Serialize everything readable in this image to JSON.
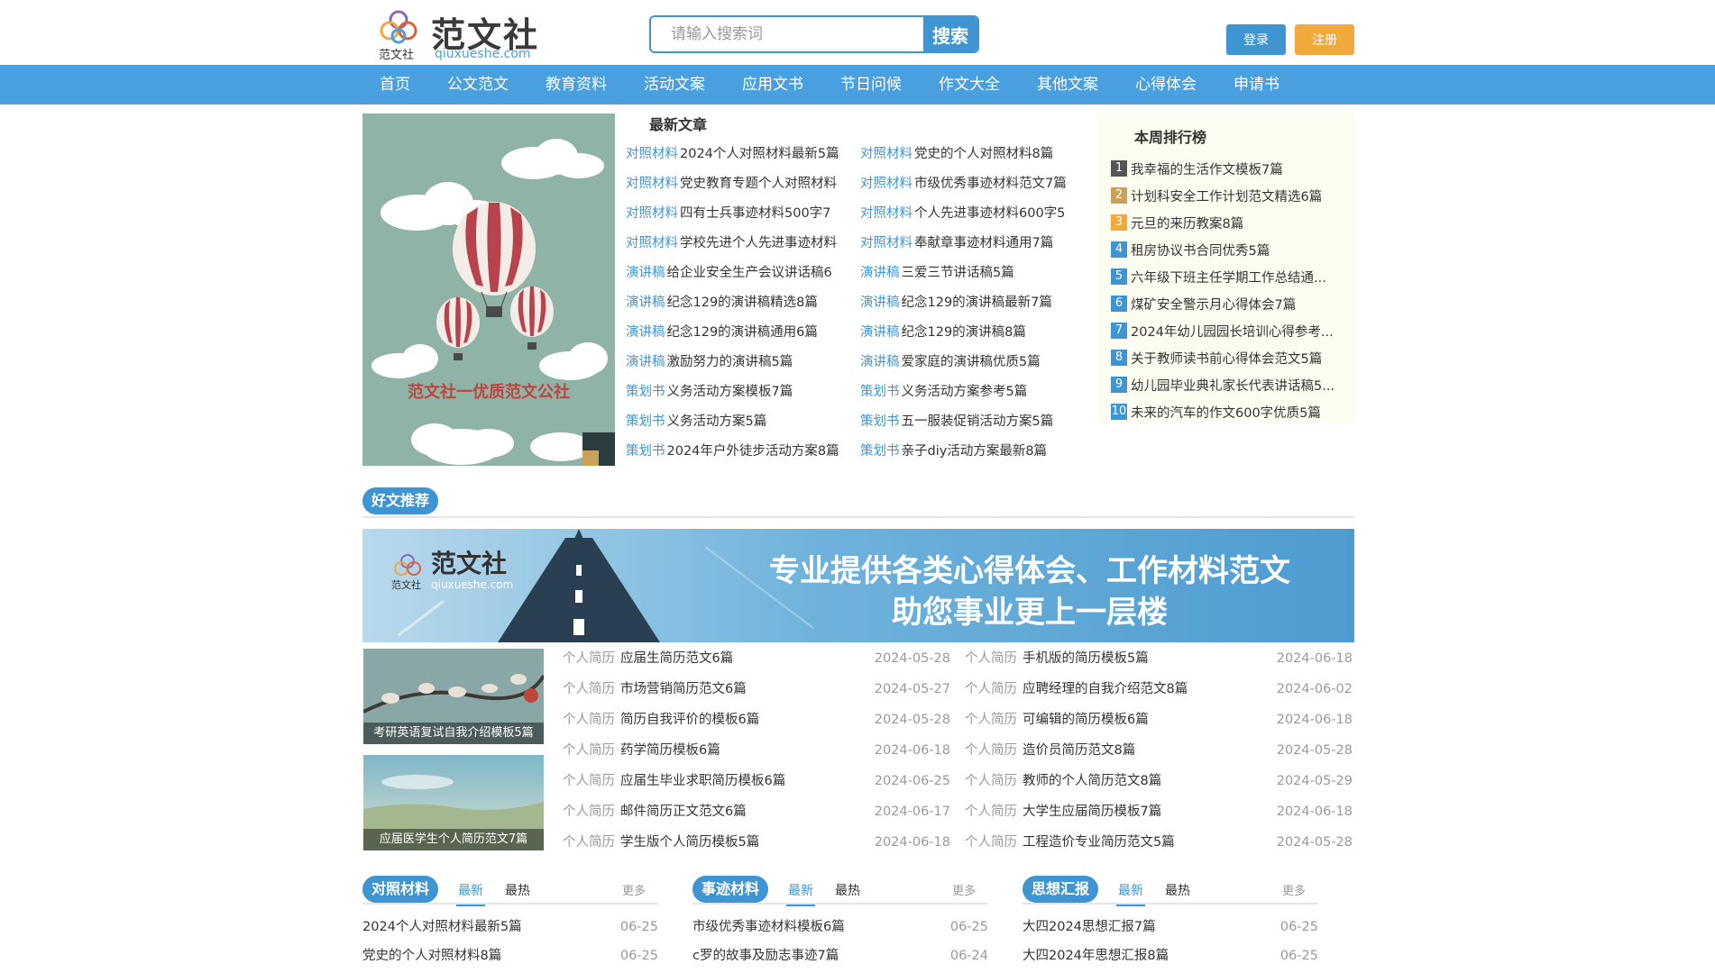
{
  "header": {
    "logo_name": "范文社",
    "logo_sub": "范文社",
    "logo_url": "qiuxueshe.com",
    "search_placeholder": "请输入搜索词",
    "search_label": "搜索",
    "login_label": "登录",
    "register_label": "注册"
  },
  "nav": [
    "首页",
    "公文范文",
    "教育资料",
    "活动文案",
    "应用文书",
    "节日问候",
    "作文大全",
    "其他文案",
    "心得体会",
    "申请书"
  ],
  "hero": {
    "caption": "范文社一优质范文公社"
  },
  "latest": {
    "heading": "最新文章",
    "items": [
      {
        "cat": "对照材料",
        "title": "2024个人对照材料最新5篇"
      },
      {
        "cat": "对照材料",
        "title": "党史的个人对照材料8篇"
      },
      {
        "cat": "对照材料",
        "title": "党史教育专题个人对照材料"
      },
      {
        "cat": "对照材料",
        "title": "市级优秀事迹材料范文7篇"
      },
      {
        "cat": "对照材料",
        "title": "四有士兵事迹材料500字7"
      },
      {
        "cat": "对照材料",
        "title": "个人先进事迹材料600字5"
      },
      {
        "cat": "对照材料",
        "title": "学校先进个人先进事迹材料"
      },
      {
        "cat": "对照材料",
        "title": "奉献章事迹材料通用7篇"
      },
      {
        "cat": "演讲稿",
        "title": "给企业安全生产会议讲话稿6"
      },
      {
        "cat": "演讲稿",
        "title": "三爱三节讲话稿5篇"
      },
      {
        "cat": "演讲稿",
        "title": "纪念129的演讲稿精选8篇"
      },
      {
        "cat": "演讲稿",
        "title": "纪念129的演讲稿最新7篇"
      },
      {
        "cat": "演讲稿",
        "title": "纪念129的演讲稿通用6篇"
      },
      {
        "cat": "演讲稿",
        "title": "纪念129的演讲稿8篇"
      },
      {
        "cat": "演讲稿",
        "title": "激励努力的演讲稿5篇"
      },
      {
        "cat": "演讲稿",
        "title": "爱家庭的演讲稿优质5篇"
      },
      {
        "cat": "策划书",
        "title": "义务活动方案模板7篇"
      },
      {
        "cat": "策划书",
        "title": "义务活动方案参考5篇"
      },
      {
        "cat": "策划书",
        "title": "义务活动方案5篇"
      },
      {
        "cat": "策划书",
        "title": "五一服装促销活动方案5篇"
      },
      {
        "cat": "策划书",
        "title": "2024年户外徒步活动方案8篇"
      },
      {
        "cat": "策划书",
        "title": "亲子diy活动方案最新8篇"
      }
    ]
  },
  "rank": {
    "heading": "本周排行榜",
    "items": [
      {
        "num": "1",
        "title": "我幸福的生活作文模板7篇",
        "color": "#555555"
      },
      {
        "num": "2",
        "title": "计划科安全工作计划范文精选6篇",
        "color": "#c8a15a"
      },
      {
        "num": "3",
        "title": "元旦的来历教案8篇",
        "color": "#f2a93b"
      },
      {
        "num": "4",
        "title": "租房协议书合同优秀5篇",
        "color": "#3f95d1"
      },
      {
        "num": "5",
        "title": "六年级下班主任学期工作总结通...",
        "color": "#3f95d1"
      },
      {
        "num": "6",
        "title": "煤矿安全警示月心得体会7篇",
        "color": "#3f95d1"
      },
      {
        "num": "7",
        "title": "2024年幼儿园园长培训心得参考...",
        "color": "#3f95d1"
      },
      {
        "num": "8",
        "title": "关于教师读书前心得体会范文5篇",
        "color": "#3f95d1"
      },
      {
        "num": "9",
        "title": "幼儿园毕业典礼家长代表讲话稿5...",
        "color": "#3f95d1"
      },
      {
        "num": "10",
        "title": "未来的汽车的作文600字优质5篇",
        "color": "#3f95d1"
      }
    ]
  },
  "recommend": {
    "heading": "好文推荐",
    "banner": {
      "logo_name": "范文社",
      "logo_sub": "范文社",
      "logo_url": "qiuxueshe.com",
      "line1": "专业提供各类心得体会、工作材料范文",
      "line2": "助您事业更上一层楼"
    },
    "thumbs": [
      {
        "caption": "考研英语复试自我介绍模板5篇"
      },
      {
        "caption": "应届医学生个人简历范文7篇"
      }
    ],
    "left": [
      {
        "cat": "个人简历",
        "title": "应届生简历范文6篇",
        "date": "2024-05-28"
      },
      {
        "cat": "个人简历",
        "title": "市场营销简历范文6篇",
        "date": "2024-05-27"
      },
      {
        "cat": "个人简历",
        "title": "简历自我评价的模板6篇",
        "date": "2024-05-28"
      },
      {
        "cat": "个人简历",
        "title": "药学简历模板6篇",
        "date": "2024-06-18"
      },
      {
        "cat": "个人简历",
        "title": "应届生毕业求职简历模板6篇",
        "date": "2024-06-25"
      },
      {
        "cat": "个人简历",
        "title": "邮件简历正文范文6篇",
        "date": "2024-06-17"
      },
      {
        "cat": "个人简历",
        "title": "学生版个人简历模板5篇",
        "date": "2024-06-18"
      }
    ],
    "right": [
      {
        "cat": "个人简历",
        "title": "手机版的简历模板5篇",
        "date": "2024-06-18"
      },
      {
        "cat": "个人简历",
        "title": "应聘经理的自我介绍范文8篇",
        "date": "2024-06-02"
      },
      {
        "cat": "个人简历",
        "title": "可编辑的简历模板6篇",
        "date": "2024-06-18"
      },
      {
        "cat": "个人简历",
        "title": "造价员简历范文8篇",
        "date": "2024-05-28"
      },
      {
        "cat": "个人简历",
        "title": "教师的个人简历范文8篇",
        "date": "2024-05-29"
      },
      {
        "cat": "个人简历",
        "title": "大学生应届简历模板7篇",
        "date": "2024-06-18"
      },
      {
        "cat": "个人简历",
        "title": "工程造价专业简历范文5篇",
        "date": "2024-05-28"
      }
    ]
  },
  "panels": [
    {
      "title": "对照材料",
      "tab_new": "最新",
      "tab_hot": "最热",
      "more": "更多",
      "items": [
        {
          "title": "2024个人对照材料最新5篇",
          "date": "06-25"
        },
        {
          "title": "党史的个人对照材料8篇",
          "date": "06-25"
        }
      ]
    },
    {
      "title": "事迹材料",
      "tab_new": "最新",
      "tab_hot": "最热",
      "more": "更多",
      "items": [
        {
          "title": "市级优秀事迹材料模板6篇",
          "date": "06-25"
        },
        {
          "title": "c罗的故事及励志事迹7篇",
          "date": "06-24"
        }
      ]
    },
    {
      "title": "思想汇报",
      "tab_new": "最新",
      "tab_hot": "最热",
      "more": "更多",
      "items": [
        {
          "title": "大四2024思想汇报7篇",
          "date": "06-25"
        },
        {
          "title": "大四2024年思想汇报8篇",
          "date": "06-25"
        }
      ]
    }
  ]
}
